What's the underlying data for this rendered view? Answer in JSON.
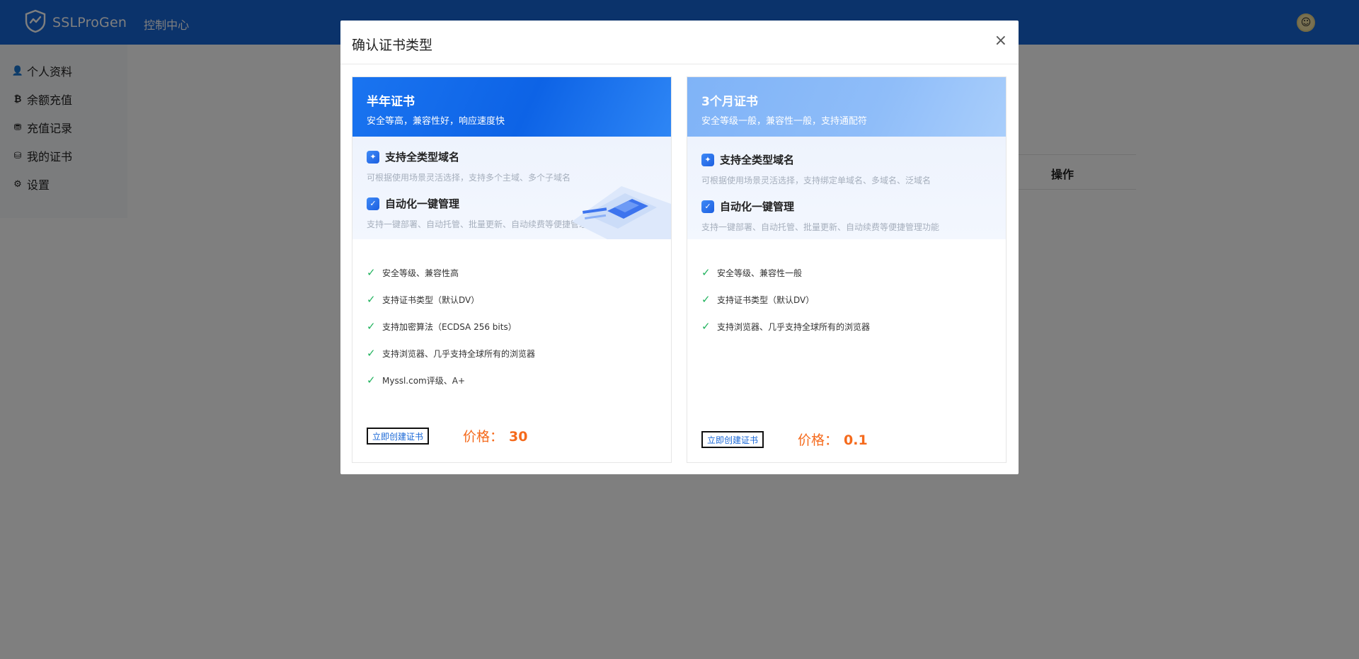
{
  "app": {
    "brand": "SSLProGen",
    "nav_link": "控制中心"
  },
  "sidebar": {
    "items": [
      {
        "label": "个人资料",
        "icon": "user-plus-icon"
      },
      {
        "label": "余额充值",
        "icon": "bitcoin-icon"
      },
      {
        "label": "充值记录",
        "icon": "coins-icon"
      },
      {
        "label": "我的证书",
        "icon": "database-icon"
      },
      {
        "label": "设置",
        "icon": "gear-icon"
      }
    ]
  },
  "background": {
    "table_header_action": "操作"
  },
  "modal": {
    "title": "确认证书类型",
    "close": "×",
    "cards": [
      {
        "title": "半年证书",
        "subtitle": "安全等高，兼容性好，响应速度快",
        "features": [
          {
            "title": "支持全类型域名",
            "desc": "可根据使用场景灵活选择，支持多个主域、多个子域名"
          },
          {
            "title": "自动化一键管理",
            "desc": "支持一键部署、自动托管、批量更新、自动续费等便捷管理功能"
          }
        ],
        "checks": [
          "安全等级、兼容性高",
          "支持证书类型（默认DV）",
          "支持加密算法（ECDSA 256 bits）",
          "支持浏览器、几乎支持全球所有的浏览器",
          "Myssl.com评级、A+"
        ],
        "button": "立即创建证书",
        "price_label": "价格：",
        "price_value": "30"
      },
      {
        "title": "3个月证书",
        "subtitle": "安全等级一般，兼容性一般，支持通配符",
        "features": [
          {
            "title": "支持全类型域名",
            "desc": "可根据使用场景灵活选择，支持绑定单域名、多域名、泛域名"
          },
          {
            "title": "自动化一键管理",
            "desc": "支持一键部署、自动托管、批量更新、自动续费等便捷管理功能"
          }
        ],
        "checks": [
          "安全等级、兼容性一般",
          "支持证书类型（默认DV）",
          "支持浏览器、几乎支持全球所有的浏览器"
        ],
        "button": "立即创建证书",
        "price_label": "价格：",
        "price_value": "0.1"
      }
    ]
  },
  "colors": {
    "topbar": "#1766d6",
    "price": "#f56a1c",
    "check": "#22b35e"
  }
}
